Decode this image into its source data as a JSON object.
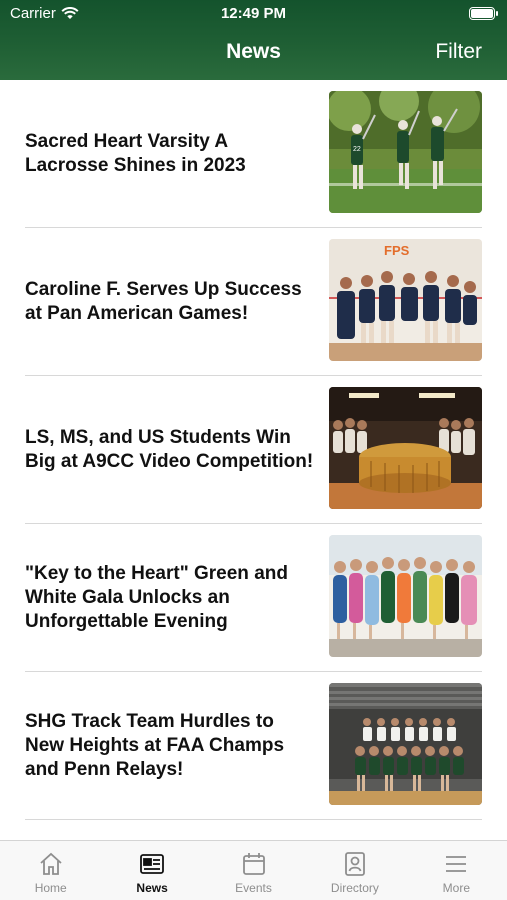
{
  "status_bar": {
    "carrier": "Carrier",
    "time": "12:49 PM"
  },
  "nav": {
    "title": "News",
    "filter_label": "Filter"
  },
  "news": [
    {
      "title": "Sacred Heart Varsity A Lacrosse Shines in 2023"
    },
    {
      "title": "Caroline F. Serves Up Success at Pan American Games!",
      "thumb_text": "FPS"
    },
    {
      "title": "LS, MS, and US Students Win Big at A9CC Video Competition!"
    },
    {
      "title": "\"Key to the Heart\" Green and White Gala Unlocks an Unforgettable Evening"
    },
    {
      "title": "SHG Track Team Hurdles to New Heights at FAA Champs and Penn Relays!"
    }
  ],
  "tabs": [
    {
      "label": "Home",
      "icon": "home-icon"
    },
    {
      "label": "News",
      "icon": "news-icon",
      "active": true
    },
    {
      "label": "Events",
      "icon": "calendar-icon"
    },
    {
      "label": "Directory",
      "icon": "directory-icon"
    },
    {
      "label": "More",
      "icon": "menu-icon"
    }
  ],
  "colors": {
    "header": "#1f5f34",
    "active_tab": "#111111",
    "inactive_tab": "#8e8e8e"
  }
}
